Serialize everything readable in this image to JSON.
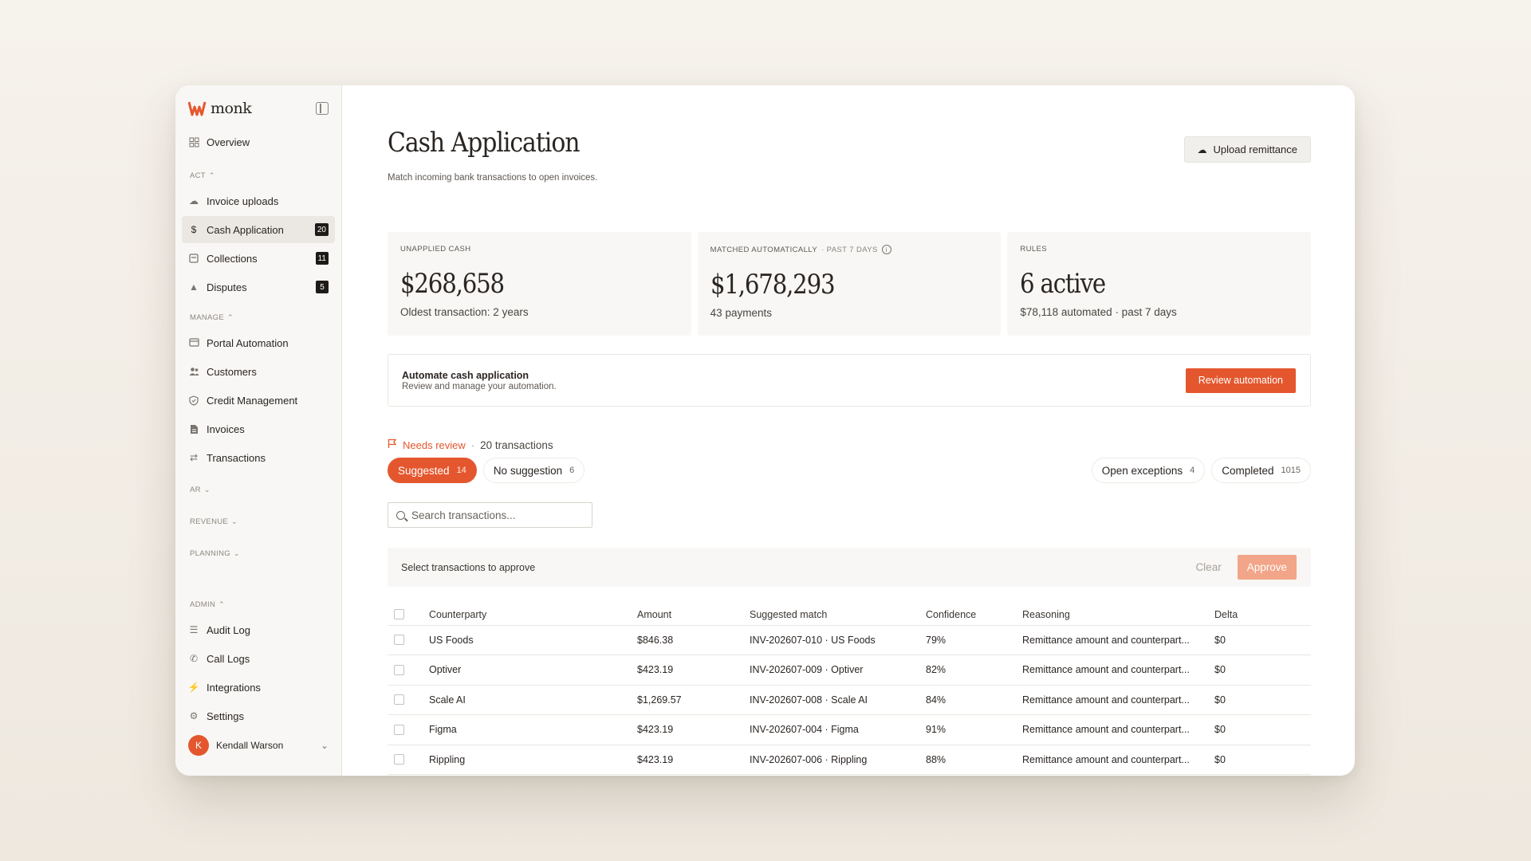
{
  "brand": {
    "name": "monk",
    "accent": "#e4572e"
  },
  "sidebar": {
    "overview": "Overview",
    "sections": {
      "act": "ACT",
      "manage": "MANAGE",
      "ar": "AR",
      "revenue": "REVENUE",
      "planning": "PLANNING",
      "admin": "ADMIN"
    },
    "act_items": [
      {
        "label": "Invoice uploads",
        "icon": "upload-icon"
      },
      {
        "label": "Cash Application",
        "icon": "dollar-icon",
        "badge": "20",
        "active": true
      },
      {
        "label": "Collections",
        "icon": "collections-icon",
        "badge": "11"
      },
      {
        "label": "Disputes",
        "icon": "warning-icon",
        "badge": "5"
      }
    ],
    "manage_items": [
      {
        "label": "Portal Automation",
        "icon": "portal-icon"
      },
      {
        "label": "Customers",
        "icon": "users-icon"
      },
      {
        "label": "Credit Management",
        "icon": "shield-icon"
      },
      {
        "label": "Invoices",
        "icon": "document-icon"
      },
      {
        "label": "Transactions",
        "icon": "transactions-icon"
      }
    ],
    "admin_items": [
      {
        "label": "Audit Log",
        "icon": "list-icon"
      },
      {
        "label": "Call Logs",
        "icon": "phone-icon"
      },
      {
        "label": "Integrations",
        "icon": "plug-icon"
      },
      {
        "label": "Settings",
        "icon": "gear-icon"
      }
    ],
    "user": {
      "initial": "K",
      "name": "Kendall Warson"
    }
  },
  "header": {
    "title": "Cash Application",
    "subtitle": "Match incoming bank transactions to open invoices.",
    "upload_label": "Upload remittance"
  },
  "stats": {
    "unapplied": {
      "label": "UNAPPLIED CASH",
      "value": "$268,658",
      "foot": "Oldest transaction: 2 years"
    },
    "matched": {
      "label": "MATCHED AUTOMATICALLY",
      "period": "· PAST 7 DAYS",
      "value": "$1,678,293",
      "foot": "43 payments"
    },
    "rules": {
      "label": "RULES",
      "value": "6 active",
      "foot": "$78,118 automated · past 7 days"
    }
  },
  "automation": {
    "title": "Automate cash application",
    "subtitle": "Review and manage your automation.",
    "button": "Review automation"
  },
  "review": {
    "needs_label": "Needs review",
    "dot": "·",
    "count_text": "20 transactions"
  },
  "tabs": {
    "suggested": {
      "label": "Suggested",
      "count": "14"
    },
    "no_suggestion": {
      "label": "No suggestion",
      "count": "6"
    },
    "open_exceptions": {
      "label": "Open exceptions",
      "count": "4"
    },
    "completed": {
      "label": "Completed",
      "count": "1015"
    }
  },
  "search": {
    "placeholder": "Search transactions..."
  },
  "selection": {
    "text": "Select transactions to approve",
    "clear": "Clear",
    "approve": "Approve"
  },
  "table": {
    "headers": [
      "Counterparty",
      "Amount",
      "Suggested match",
      "Confidence",
      "Reasoning",
      "Delta"
    ],
    "rows": [
      {
        "counterparty": "US Foods",
        "amount": "$846.38",
        "match": "INV-202607-010 · US Foods",
        "confidence": "79%",
        "reasoning": "Remittance amount and counterpart...",
        "delta": "$0"
      },
      {
        "counterparty": "Optiver",
        "amount": "$423.19",
        "match": "INV-202607-009 · Optiver",
        "confidence": "82%",
        "reasoning": "Remittance amount and counterpart...",
        "delta": "$0"
      },
      {
        "counterparty": "Scale AI",
        "amount": "$1,269.57",
        "match": "INV-202607-008 · Scale AI",
        "confidence": "84%",
        "reasoning": "Remittance amount and counterpart...",
        "delta": "$0"
      },
      {
        "counterparty": "Figma",
        "amount": "$423.19",
        "match": "INV-202607-004 · Figma",
        "confidence": "91%",
        "reasoning": "Remittance amount and counterpart...",
        "delta": "$0"
      },
      {
        "counterparty": "Rippling",
        "amount": "$423.19",
        "match": "INV-202607-006 · Rippling",
        "confidence": "88%",
        "reasoning": "Remittance amount and counterpart...",
        "delta": "$0"
      }
    ]
  }
}
